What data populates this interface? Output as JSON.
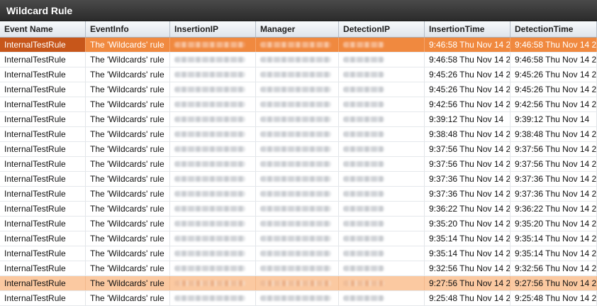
{
  "window": {
    "title": "Wildcard Rule"
  },
  "table": {
    "columns": [
      "Event Name",
      "EventInfo",
      "InsertionIP",
      "Manager",
      "DetectionIP",
      "InsertionTime",
      "DetectionTime"
    ],
    "rows": [
      {
        "event_name": "InternalTestRule",
        "event_info": "The 'Wildcards' rule",
        "insertion_time": "9:46:58 Thu Nov 14 2",
        "detection_time": "9:46:58 Thu Nov 14 2"
      },
      {
        "event_name": "InternalTestRule",
        "event_info": "The 'Wildcards' rule",
        "insertion_time": "9:46:58 Thu Nov 14 2",
        "detection_time": "9:46:58 Thu Nov 14 2"
      },
      {
        "event_name": "InternalTestRule",
        "event_info": "The 'Wildcards' rule",
        "insertion_time": "9:45:26 Thu Nov 14 2",
        "detection_time": "9:45:26 Thu Nov 14 2"
      },
      {
        "event_name": "InternalTestRule",
        "event_info": "The 'Wildcards' rule",
        "insertion_time": "9:45:26 Thu Nov 14 2",
        "detection_time": "9:45:26 Thu Nov 14 2"
      },
      {
        "event_name": "InternalTestRule",
        "event_info": "The 'Wildcards' rule",
        "insertion_time": "9:42:56 Thu Nov 14 2",
        "detection_time": "9:42:56 Thu Nov 14 2"
      },
      {
        "event_name": "InternalTestRule",
        "event_info": "The 'Wildcards' rule",
        "insertion_time": "9:39:12 Thu Nov 14",
        "detection_time": "9:39:12 Thu Nov 14"
      },
      {
        "event_name": "InternalTestRule",
        "event_info": "The 'Wildcards' rule",
        "insertion_time": "9:38:48 Thu Nov 14 2",
        "detection_time": "9:38:48 Thu Nov 14 2"
      },
      {
        "event_name": "InternalTestRule",
        "event_info": "The 'Wildcards' rule",
        "insertion_time": "9:37:56 Thu Nov 14 2",
        "detection_time": "9:37:56 Thu Nov 14 2"
      },
      {
        "event_name": "InternalTestRule",
        "event_info": "The 'Wildcards' rule",
        "insertion_time": "9:37:56 Thu Nov 14 2",
        "detection_time": "9:37:56 Thu Nov 14 2"
      },
      {
        "event_name": "InternalTestRule",
        "event_info": "The 'Wildcards' rule",
        "insertion_time": "9:37:36 Thu Nov 14 2",
        "detection_time": "9:37:36 Thu Nov 14 2"
      },
      {
        "event_name": "InternalTestRule",
        "event_info": "The 'Wildcards' rule",
        "insertion_time": "9:37:36 Thu Nov 14 2",
        "detection_time": "9:37:36 Thu Nov 14 2"
      },
      {
        "event_name": "InternalTestRule",
        "event_info": "The 'Wildcards' rule",
        "insertion_time": "9:36:22 Thu Nov 14 2",
        "detection_time": "9:36:22 Thu Nov 14 2"
      },
      {
        "event_name": "InternalTestRule",
        "event_info": "The 'Wildcards' rule",
        "insertion_time": "9:35:20 Thu Nov 14 2",
        "detection_time": "9:35:20 Thu Nov 14 2"
      },
      {
        "event_name": "InternalTestRule",
        "event_info": "The 'Wildcards' rule",
        "insertion_time": "9:35:14 Thu Nov 14 2",
        "detection_time": "9:35:14 Thu Nov 14 2"
      },
      {
        "event_name": "InternalTestRule",
        "event_info": "The 'Wildcards' rule",
        "insertion_time": "9:35:14 Thu Nov 14 2",
        "detection_time": "9:35:14 Thu Nov 14 2"
      },
      {
        "event_name": "InternalTestRule",
        "event_info": "The 'Wildcards' rule",
        "insertion_time": "9:32:56 Thu Nov 14 2",
        "detection_time": "9:32:56 Thu Nov 14 2"
      },
      {
        "event_name": "InternalTestRule",
        "event_info": "The 'Wildcards' rule",
        "insertion_time": "9:27:56 Thu Nov 14 2",
        "detection_time": "9:27:56 Thu Nov 14 2"
      },
      {
        "event_name": "InternalTestRule",
        "event_info": "The 'Wildcards' rule",
        "insertion_time": "9:25:48 Thu Nov 14 2",
        "detection_time": "9:25:48 Thu Nov 14 2"
      }
    ],
    "selected_row": 0,
    "highlighted_row": 16
  },
  "colors": {
    "titlebar": "#333333",
    "selection": "#f0893f",
    "selection_cell": "#c7561a",
    "highlight": "#fbc9a1"
  }
}
